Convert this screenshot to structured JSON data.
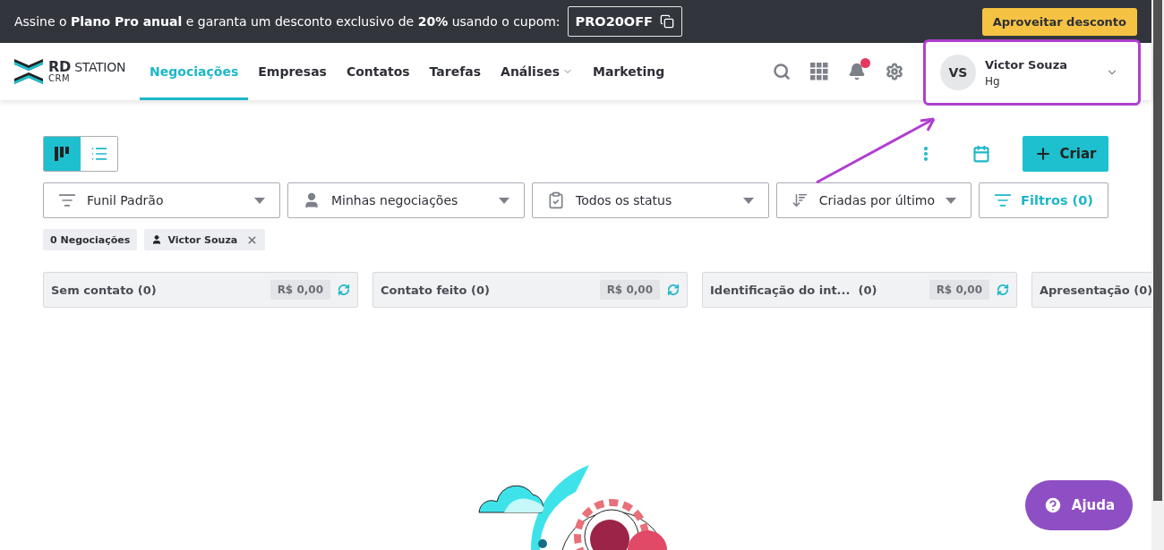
{
  "banner": {
    "text": "Assine o **Plano Pro anual** e garanta um desconto exclusivo de **20%** usando o cupom:",
    "coupon": "PRO20OFF",
    "cta": "Aproveitar desconto"
  },
  "nav": {
    "logo": {
      "primary": "**RD** STATION",
      "secondary": "CRM"
    },
    "items": [
      {
        "label": "Negociações",
        "selected": true,
        "has_menu": false
      },
      {
        "label": "Empresas",
        "selected": false,
        "has_menu": false
      },
      {
        "label": "Contatos",
        "selected": false,
        "has_menu": false
      },
      {
        "label": "Tarefas",
        "selected": false,
        "has_menu": false
      },
      {
        "label": "Análises",
        "selected": false,
        "has_menu": true
      },
      {
        "label": "Marketing",
        "selected": false,
        "has_menu": false
      }
    ],
    "notifications": {
      "unread": true
    },
    "user": {
      "initials": "VS",
      "name": "Victor Souza",
      "account": "Hg",
      "highlighted": true
    }
  },
  "view_toggle": [
    {
      "kind": "board",
      "selected": true
    },
    {
      "kind": "list",
      "selected": false
    }
  ],
  "create_button": "Criar",
  "filters": [
    {
      "kind": "funnel",
      "label": "Funil Padrão"
    },
    {
      "kind": "owner",
      "label": "Minhas negociações"
    },
    {
      "kind": "status",
      "label": "Todos os status"
    },
    {
      "kind": "sort",
      "label": "Criadas por último"
    }
  ],
  "filters_button": "Filtros (0)",
  "chips": [
    {
      "kind": "count",
      "label": "0 Negociações"
    },
    {
      "kind": "user",
      "label": "Victor Souza",
      "removable": true
    }
  ],
  "stages": [
    {
      "name": "Sem contato (0)",
      "amount": "R$ 0,00"
    },
    {
      "name": "Contato feito (0)",
      "amount": "R$ 0,00"
    },
    {
      "name": "Identificação do int...  (0)",
      "amount": "R$ 0,00"
    },
    {
      "name": "Apresentação (0)"
    }
  ],
  "help_button": "Ajuda"
}
